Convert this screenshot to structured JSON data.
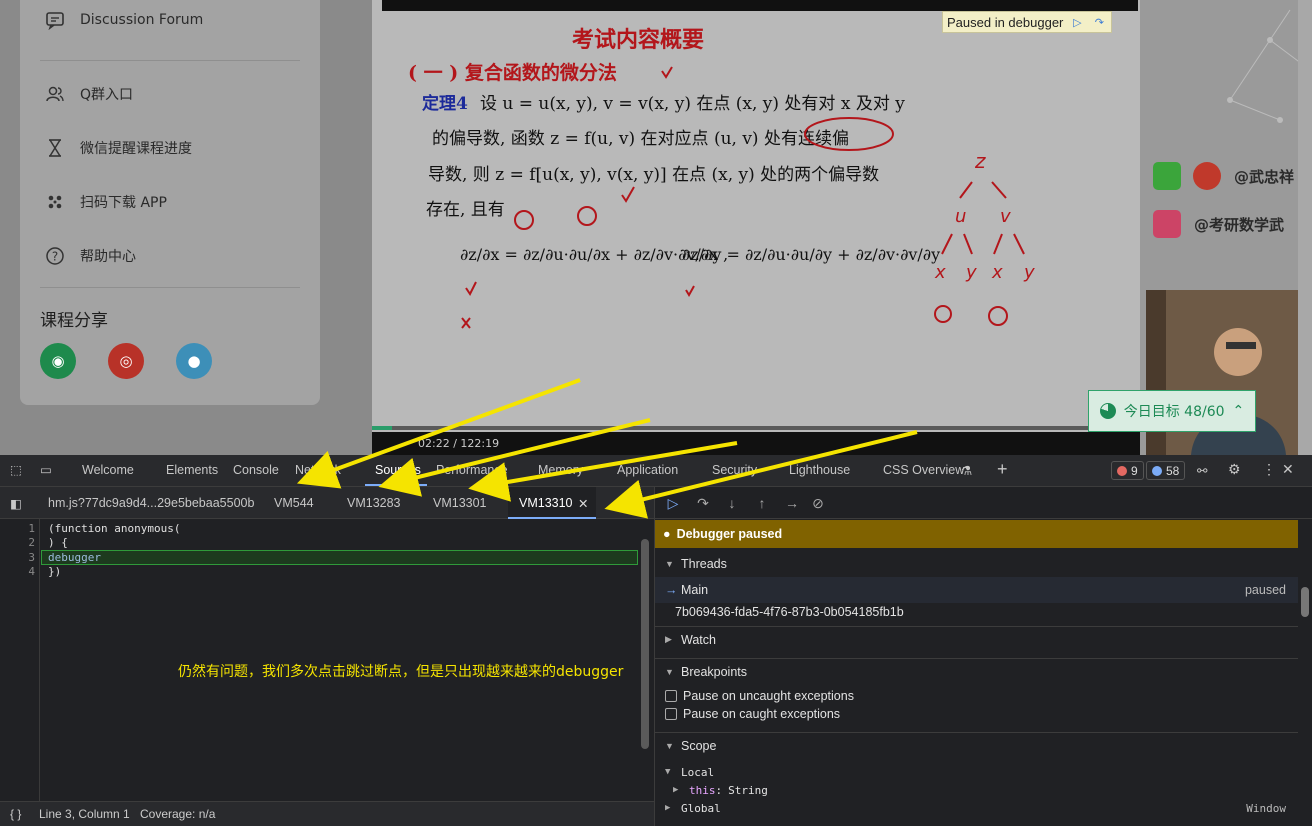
{
  "sidebar": {
    "items": [
      {
        "label": "Discussion Forum",
        "icon": "forum-icon"
      },
      {
        "label": "Q群入口",
        "icon": "user-group-icon"
      },
      {
        "label": "微信提醒课程进度",
        "icon": "hourglass-icon"
      },
      {
        "label": "扫码下载 APP",
        "icon": "app-grid-icon"
      },
      {
        "label": "帮助中心",
        "icon": "help-icon"
      }
    ],
    "share_title": "课程分享",
    "share_buttons": [
      "wechat-icon",
      "weibo-icon",
      "qq-icon"
    ]
  },
  "video": {
    "paused_label": "Paused in debugger",
    "slide": {
      "heading": "考试内容概要",
      "section": "( 一 ) 复合函数的微分法",
      "theorem_label": "定理4",
      "line1": "设 u = u(x, y), v = v(x, y) 在点 (x, y) 处有对 x 及对 y",
      "line2": "的偏导数, 函数 z = f(u, v) 在对应点 (u, v) 处有连续偏",
      "line3": "导数, 则 z = f[u(x, y), v(x, y)] 在点 (x, y) 处的两个偏导数",
      "line4": "存在, 且有",
      "formula1": "∂z/∂x = ∂z/∂u·∂u/∂x + ∂z/∂v·∂v/∂x ,",
      "formula2": "∂z/∂y = ∂z/∂u·∂u/∂y + ∂z/∂v·∂v/∂y"
    },
    "time": "02:22 / 122:19"
  },
  "right_panel": {
    "weibo_handle": "@武忠祥",
    "bilibili_handle": "@考研数学武",
    "goal": "今日目标 48/60",
    "goal_fraction": 0.8
  },
  "devtools": {
    "tabs": [
      "Welcome",
      "Elements",
      "Console",
      "Network",
      "Sources",
      "Performance",
      "Memory",
      "Application",
      "Security",
      "Lighthouse",
      "CSS Overview"
    ],
    "active_tab": "Sources",
    "error_count": "9",
    "message_count": "58",
    "file_tabs": [
      "hm.js?77dc9a9d4...29e5bebaa5500b",
      "VM544",
      "VM13283",
      "VM13301",
      "VM13310"
    ],
    "active_file": "VM13310",
    "code_lines": [
      {
        "n": "1",
        "text": "(function anonymous("
      },
      {
        "n": "2",
        "text": ") {"
      },
      {
        "n": "3",
        "text": "debugger"
      },
      {
        "n": "4",
        "text": "})"
      }
    ],
    "annotation": "仍然有问题，我们多次点击跳过断点，但是只出现越来越来的debugger",
    "status": {
      "position": "Line 3, Column 1",
      "coverage": "Coverage: n/a",
      "braces": "{ }"
    },
    "debugger": {
      "paused_banner": "Debugger paused",
      "threads_label": "Threads",
      "thread_main": "Main",
      "thread_main_status": "paused",
      "thread_id": "7b069436-fda5-4f76-87b3-0b054185fb1b",
      "watch_label": "Watch",
      "breakpoints_label": "Breakpoints",
      "pause_uncaught": "Pause on uncaught exceptions",
      "pause_caught": "Pause on caught exceptions",
      "scope_label": "Scope",
      "local_label": "Local",
      "this_key": "this",
      "this_val": "String",
      "global_label": "Global",
      "global_val": "Window"
    }
  },
  "colors": {
    "annotation": "#f5e400",
    "paused_banner": "#806200",
    "accent": "#7cacf8"
  }
}
